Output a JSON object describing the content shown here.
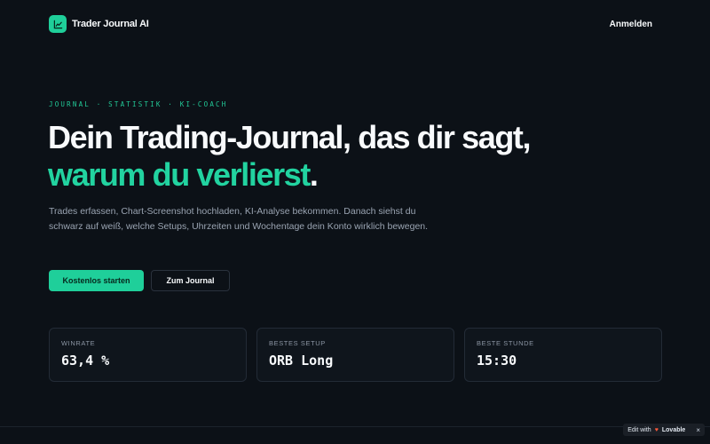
{
  "nav": {
    "brand_name": "Trader Journal AI",
    "login_label": "Anmelden"
  },
  "hero": {
    "eyebrow": "JOURNAL · STATISTIK · KI-COACH",
    "headline_part1": "Dein Trading-Journal, das dir sagt, ",
    "headline_accent": "warum du verlierst",
    "headline_end": ".",
    "subtitle": "Trades erfassen, Chart-Screenshot hochladen, KI-Analyse bekommen. Danach siehst du schwarz auf weiß, welche Setups, Uhrzeiten und Wochentage dein Konto wirklich bewegen.",
    "primary_cta": "Kostenlos starten",
    "secondary_cta": "Zum Journal"
  },
  "stats": [
    {
      "label": "WINRATE",
      "value": "63,4 %"
    },
    {
      "label": "BESTES SETUP",
      "value": "ORB Long"
    },
    {
      "label": "BESTE STUNDE",
      "value": "15:30"
    }
  ],
  "badge": {
    "prefix": "Edit with",
    "brand": "Lovable",
    "close": "×"
  },
  "colors": {
    "background": "#0c1117",
    "accent": "#1fcf9a",
    "text": "#f8fafc",
    "muted": "#9aa4b2"
  }
}
